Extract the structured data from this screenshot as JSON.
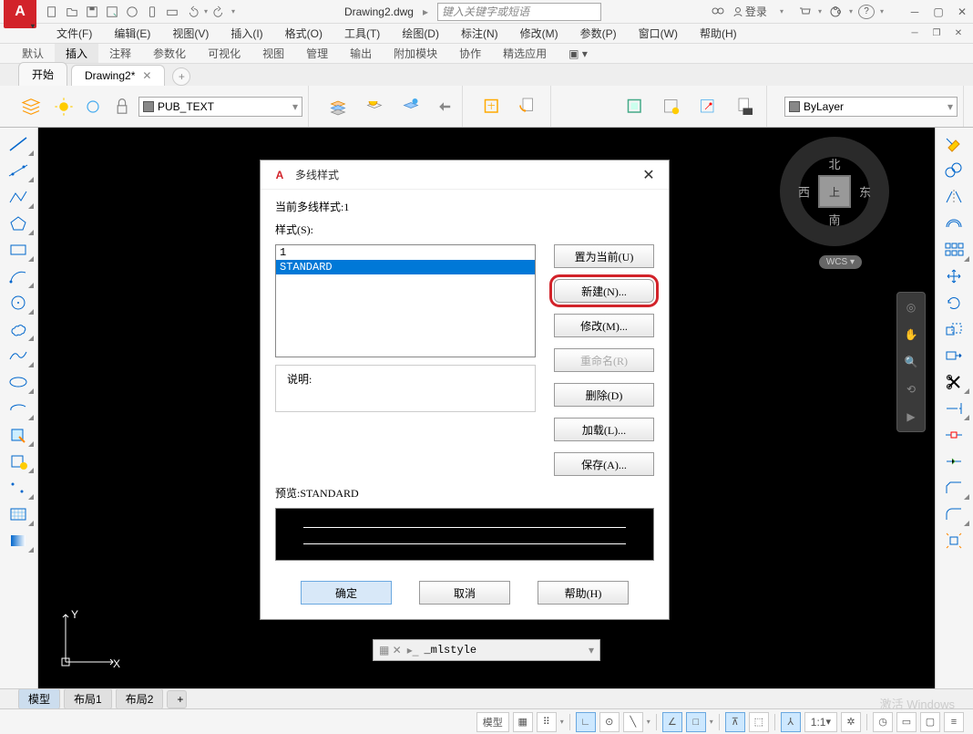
{
  "title": {
    "doc": "Drawing2.dwg",
    "search_placeholder": "键入关键字或短语",
    "login": "登录"
  },
  "menubar": [
    "文件(F)",
    "编辑(E)",
    "视图(V)",
    "插入(I)",
    "格式(O)",
    "工具(T)",
    "绘图(D)",
    "标注(N)",
    "修改(M)",
    "参数(P)",
    "窗口(W)",
    "帮助(H)"
  ],
  "ribbon_tabs": [
    "默认",
    "插入",
    "注释",
    "参数化",
    "可视化",
    "视图",
    "管理",
    "输出",
    "附加模块",
    "协作",
    "精选应用"
  ],
  "ribbon_active": 1,
  "doc_tabs": [
    {
      "label": "开始",
      "active": false
    },
    {
      "label": "Drawing2*",
      "active": true
    }
  ],
  "layer": {
    "name": "PUB_TEXT"
  },
  "bylayer": "ByLayer",
  "compass": {
    "n": "北",
    "s": "南",
    "e": "东",
    "w": "西",
    "top": "上",
    "wcs": "WCS ▾"
  },
  "dialog": {
    "title": "多线样式",
    "current_label": "当前多线样式:1",
    "styles_label": "样式(S):",
    "list": [
      "1",
      "STANDARD"
    ],
    "selected_index": 1,
    "buttons": {
      "set_current": "置为当前(U)",
      "new": "新建(N)...",
      "modify": "修改(M)...",
      "rename": "重命名(R)",
      "delete": "删除(D)",
      "load": "加载(L)...",
      "save": "保存(A)..."
    },
    "desc_label": "说明:",
    "preview_label": "预览:STANDARD",
    "ok": "确定",
    "cancel": "取消",
    "help": "帮助(H)"
  },
  "cmdline": {
    "text": "_mlstyle"
  },
  "layout_tabs": [
    "模型",
    "布局1",
    "布局2"
  ],
  "status": {
    "model": "模型",
    "scale": "1:1"
  },
  "watermark": "激活 Windows"
}
